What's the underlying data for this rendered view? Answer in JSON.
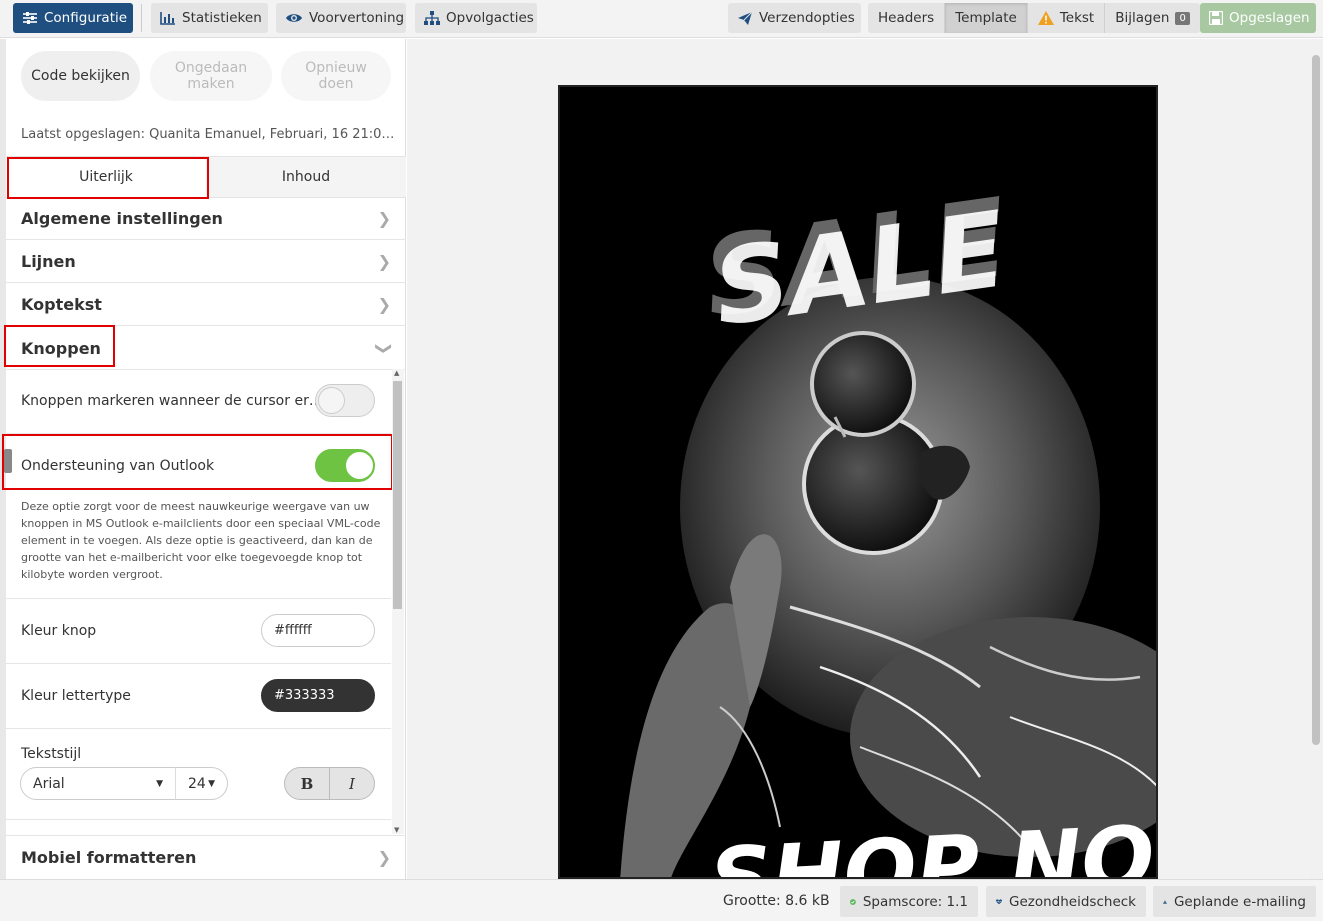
{
  "toolbar": {
    "configuratie": "Configuratie",
    "statistieken": "Statistieken",
    "voorvertoning": "Voorvertoning",
    "opvolgacties": "Opvolgacties",
    "verzendopties": "Verzendopties",
    "headers": "Headers",
    "template": "Template",
    "tekst": "Tekst",
    "bijlagen": "Bijlagen",
    "bijlagen_count": "0",
    "opgeslagen": "Opgeslagen"
  },
  "panel": {
    "code_bekijken": "Code bekijken",
    "ongedaan_maken": "Ongedaan maken",
    "opnieuw_doen": "Opnieuw doen",
    "laatst_opgeslagen": "Laatst opgeslagen:  Quanita Emanuel, Februari, 16 21:0…",
    "tabs": {
      "uiterlijk": "Uiterlijk",
      "inhoud": "Inhoud"
    },
    "sections": {
      "algemene": "Algemene instellingen",
      "lijnen": "Lijnen",
      "koptekst": "Koptekst",
      "knoppen": "Knoppen",
      "mobiel": "Mobiel formatteren"
    },
    "knoppen_hover": "Knoppen markeren wanneer de cursor er…",
    "outlook": "Ondersteuning van Outlook",
    "outlook_desc": "Deze optie zorgt voor de meest nauwkeurige weergave van uw knoppen in MS Outlook e-mailclients door een speciaal VML-code element in te voegen. Als deze optie is geactiveerd, dan kan de grootte van het e-mailbericht voor elke toegevoegde knop tot kilobyte worden vergroot.",
    "kleur_knop": "Kleur knop",
    "kleur_knop_value": "#ffffff",
    "kleur_lettertype": "Kleur lettertype",
    "kleur_lettertype_value": "#333333",
    "tekststijl": "Tekststijl",
    "font": "Arial",
    "size": "24",
    "bold": "B",
    "italic": "I"
  },
  "poster": {
    "headline": "SALE",
    "footer_text": "SHOP NOW"
  },
  "status": {
    "grootte": "Grootte: 8.6 kB",
    "spamscore": "Spamscore: 1.1",
    "gezondheid": "Gezondheidscheck",
    "gepland": "Geplande e-mailing"
  },
  "colors": {
    "primary": "#1f4f80",
    "toggle_on": "#6ec342",
    "highlight": "#e00000",
    "warning": "#f0a020"
  }
}
